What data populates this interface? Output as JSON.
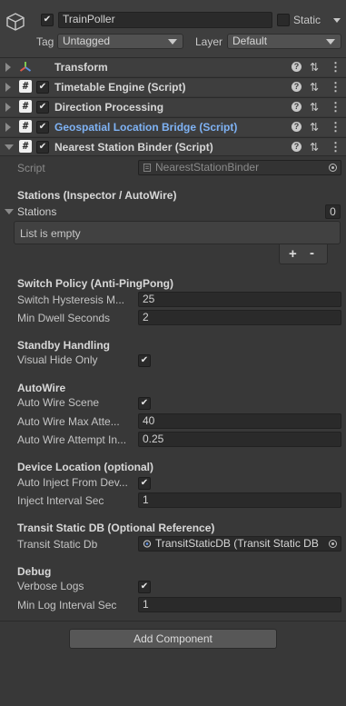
{
  "gameobject": {
    "name": "TrainPoller",
    "static_label": "Static",
    "tag_label": "Tag",
    "tag_value": "Untagged",
    "layer_label": "Layer",
    "layer_value": "Default"
  },
  "components": [
    {
      "title": "Transform",
      "icon": "transform-icon"
    },
    {
      "title": "Timetable Engine (Script)",
      "icon": "script-icon"
    },
    {
      "title": "Direction Processing",
      "icon": "script-icon"
    },
    {
      "title": "Geospatial Location Bridge (Script)",
      "icon": "script-icon"
    },
    {
      "title": "Nearest Station Binder (Script)",
      "icon": "script-icon"
    }
  ],
  "binder": {
    "script_label": "Script",
    "script_value": "NearestStationBinder",
    "stations_section": "Stations (Inspector / AutoWire)",
    "stations_label": "Stations",
    "stations_count": "0",
    "list_empty": "List is empty",
    "add_label": "+",
    "remove_label": "-",
    "switch_section": "Switch Policy (Anti-PingPong)",
    "hysteresis_label": "Switch Hysteresis M...",
    "hysteresis_value": "25",
    "dwell_label": "Min Dwell Seconds",
    "dwell_value": "2",
    "standby_section": "Standby Handling",
    "visual_hide_label": "Visual Hide Only",
    "autowire_section": "AutoWire",
    "autowire_scene_label": "Auto Wire Scene",
    "autowire_max_label": "Auto Wire Max Atte...",
    "autowire_max_value": "40",
    "autowire_interval_label": "Auto Wire Attempt In...",
    "autowire_interval_value": "0.25",
    "device_section": "Device Location (optional)",
    "auto_inject_label": "Auto Inject From Dev...",
    "inject_interval_label": "Inject Interval Sec",
    "inject_interval_value": "1",
    "transit_section": "Transit Static DB (Optional Reference)",
    "transit_label": "Transit Static Db",
    "transit_value": "TransitStaticDB (Transit Static DB",
    "debug_section": "Debug",
    "verbose_label": "Verbose Logs",
    "min_log_label": "Min Log Interval Sec",
    "min_log_value": "1"
  },
  "add_component_label": "Add Component",
  "check_glyph": "✔",
  "colors": {
    "accent_blue": "#7fb3f5",
    "background": "#383838",
    "field_bg": "#2a2a2a"
  }
}
